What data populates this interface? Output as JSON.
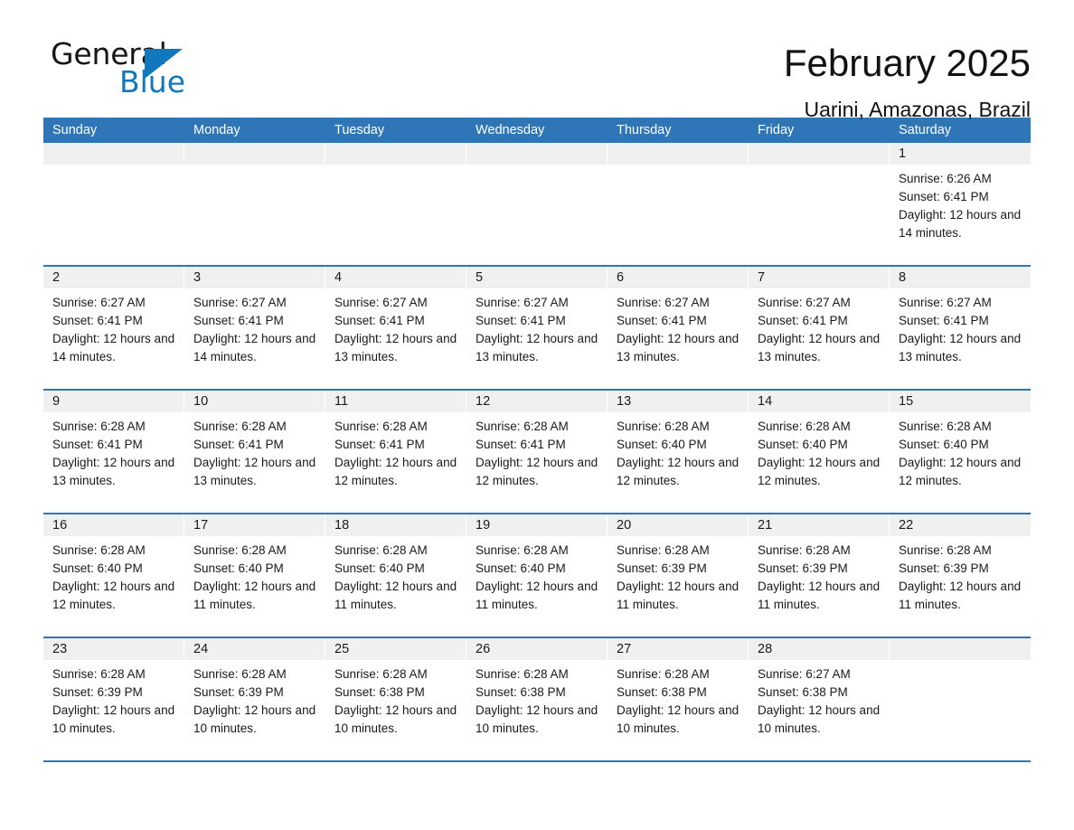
{
  "brand": {
    "name_part1": "General",
    "name_part2": "Blue",
    "accent_color": "#1278be",
    "triangle_icon": "triangle-logo-icon"
  },
  "header": {
    "title": "February 2025",
    "subtitle": "Uarini, Amazonas, Brazil"
  },
  "calendar": {
    "header_bg": "#2f76b8",
    "daynumber_bg": "#f0f0f0",
    "weekdays": [
      "Sunday",
      "Monday",
      "Tuesday",
      "Wednesday",
      "Thursday",
      "Friday",
      "Saturday"
    ],
    "weeks": [
      [
        {
          "empty": true
        },
        {
          "empty": true
        },
        {
          "empty": true
        },
        {
          "empty": true
        },
        {
          "empty": true
        },
        {
          "empty": true
        },
        {
          "day": "1",
          "sunrise": "Sunrise: 6:26 AM",
          "sunset": "Sunset: 6:41 PM",
          "daylight": "Daylight: 12 hours and 14 minutes."
        }
      ],
      [
        {
          "day": "2",
          "sunrise": "Sunrise: 6:27 AM",
          "sunset": "Sunset: 6:41 PM",
          "daylight": "Daylight: 12 hours and 14 minutes."
        },
        {
          "day": "3",
          "sunrise": "Sunrise: 6:27 AM",
          "sunset": "Sunset: 6:41 PM",
          "daylight": "Daylight: 12 hours and 14 minutes."
        },
        {
          "day": "4",
          "sunrise": "Sunrise: 6:27 AM",
          "sunset": "Sunset: 6:41 PM",
          "daylight": "Daylight: 12 hours and 13 minutes."
        },
        {
          "day": "5",
          "sunrise": "Sunrise: 6:27 AM",
          "sunset": "Sunset: 6:41 PM",
          "daylight": "Daylight: 12 hours and 13 minutes."
        },
        {
          "day": "6",
          "sunrise": "Sunrise: 6:27 AM",
          "sunset": "Sunset: 6:41 PM",
          "daylight": "Daylight: 12 hours and 13 minutes."
        },
        {
          "day": "7",
          "sunrise": "Sunrise: 6:27 AM",
          "sunset": "Sunset: 6:41 PM",
          "daylight": "Daylight: 12 hours and 13 minutes."
        },
        {
          "day": "8",
          "sunrise": "Sunrise: 6:27 AM",
          "sunset": "Sunset: 6:41 PM",
          "daylight": "Daylight: 12 hours and 13 minutes."
        }
      ],
      [
        {
          "day": "9",
          "sunrise": "Sunrise: 6:28 AM",
          "sunset": "Sunset: 6:41 PM",
          "daylight": "Daylight: 12 hours and 13 minutes."
        },
        {
          "day": "10",
          "sunrise": "Sunrise: 6:28 AM",
          "sunset": "Sunset: 6:41 PM",
          "daylight": "Daylight: 12 hours and 13 minutes."
        },
        {
          "day": "11",
          "sunrise": "Sunrise: 6:28 AM",
          "sunset": "Sunset: 6:41 PM",
          "daylight": "Daylight: 12 hours and 12 minutes."
        },
        {
          "day": "12",
          "sunrise": "Sunrise: 6:28 AM",
          "sunset": "Sunset: 6:41 PM",
          "daylight": "Daylight: 12 hours and 12 minutes."
        },
        {
          "day": "13",
          "sunrise": "Sunrise: 6:28 AM",
          "sunset": "Sunset: 6:40 PM",
          "daylight": "Daylight: 12 hours and 12 minutes."
        },
        {
          "day": "14",
          "sunrise": "Sunrise: 6:28 AM",
          "sunset": "Sunset: 6:40 PM",
          "daylight": "Daylight: 12 hours and 12 minutes."
        },
        {
          "day": "15",
          "sunrise": "Sunrise: 6:28 AM",
          "sunset": "Sunset: 6:40 PM",
          "daylight": "Daylight: 12 hours and 12 minutes."
        }
      ],
      [
        {
          "day": "16",
          "sunrise": "Sunrise: 6:28 AM",
          "sunset": "Sunset: 6:40 PM",
          "daylight": "Daylight: 12 hours and 12 minutes."
        },
        {
          "day": "17",
          "sunrise": "Sunrise: 6:28 AM",
          "sunset": "Sunset: 6:40 PM",
          "daylight": "Daylight: 12 hours and 11 minutes."
        },
        {
          "day": "18",
          "sunrise": "Sunrise: 6:28 AM",
          "sunset": "Sunset: 6:40 PM",
          "daylight": "Daylight: 12 hours and 11 minutes."
        },
        {
          "day": "19",
          "sunrise": "Sunrise: 6:28 AM",
          "sunset": "Sunset: 6:40 PM",
          "daylight": "Daylight: 12 hours and 11 minutes."
        },
        {
          "day": "20",
          "sunrise": "Sunrise: 6:28 AM",
          "sunset": "Sunset: 6:39 PM",
          "daylight": "Daylight: 12 hours and 11 minutes."
        },
        {
          "day": "21",
          "sunrise": "Sunrise: 6:28 AM",
          "sunset": "Sunset: 6:39 PM",
          "daylight": "Daylight: 12 hours and 11 minutes."
        },
        {
          "day": "22",
          "sunrise": "Sunrise: 6:28 AM",
          "sunset": "Sunset: 6:39 PM",
          "daylight": "Daylight: 12 hours and 11 minutes."
        }
      ],
      [
        {
          "day": "23",
          "sunrise": "Sunrise: 6:28 AM",
          "sunset": "Sunset: 6:39 PM",
          "daylight": "Daylight: 12 hours and 10 minutes."
        },
        {
          "day": "24",
          "sunrise": "Sunrise: 6:28 AM",
          "sunset": "Sunset: 6:39 PM",
          "daylight": "Daylight: 12 hours and 10 minutes."
        },
        {
          "day": "25",
          "sunrise": "Sunrise: 6:28 AM",
          "sunset": "Sunset: 6:38 PM",
          "daylight": "Daylight: 12 hours and 10 minutes."
        },
        {
          "day": "26",
          "sunrise": "Sunrise: 6:28 AM",
          "sunset": "Sunset: 6:38 PM",
          "daylight": "Daylight: 12 hours and 10 minutes."
        },
        {
          "day": "27",
          "sunrise": "Sunrise: 6:28 AM",
          "sunset": "Sunset: 6:38 PM",
          "daylight": "Daylight: 12 hours and 10 minutes."
        },
        {
          "day": "28",
          "sunrise": "Sunrise: 6:27 AM",
          "sunset": "Sunset: 6:38 PM",
          "daylight": "Daylight: 12 hours and 10 minutes."
        },
        {
          "empty": true
        }
      ]
    ]
  }
}
